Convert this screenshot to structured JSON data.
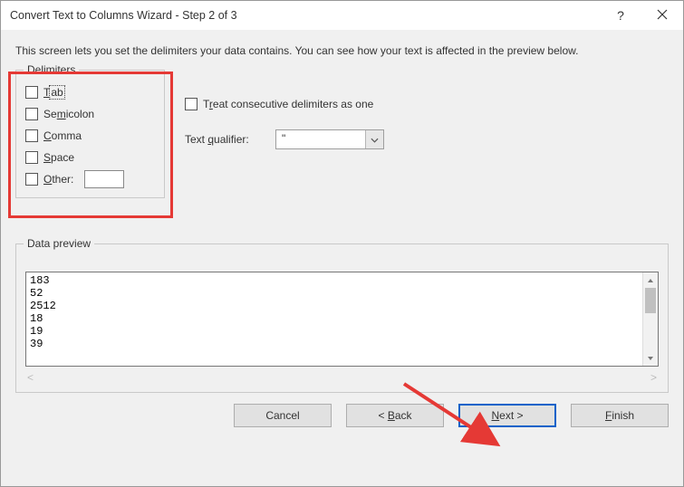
{
  "title": "Convert Text to Columns Wizard - Step 2 of 3",
  "description": "This screen lets you set the delimiters your data contains.  You can see how your text is affected in the preview below.",
  "delimiters": {
    "legend": "Delimiters",
    "tab": "Tab",
    "semicolon": "Semicolon",
    "comma": "Comma",
    "space": "Space",
    "other": "Other:"
  },
  "options": {
    "treat_consecutive": "Treat consecutive delimiters as one",
    "text_qualifier_label": "Text qualifier:",
    "text_qualifier_value": "\""
  },
  "preview": {
    "legend": "Data preview",
    "lines": [
      "183",
      "52",
      "2512",
      "18",
      "19",
      "39"
    ]
  },
  "buttons": {
    "cancel": "Cancel",
    "back": "< Back",
    "next": "Next >",
    "finish": "Finish"
  },
  "titlebar": {
    "help": "?"
  }
}
